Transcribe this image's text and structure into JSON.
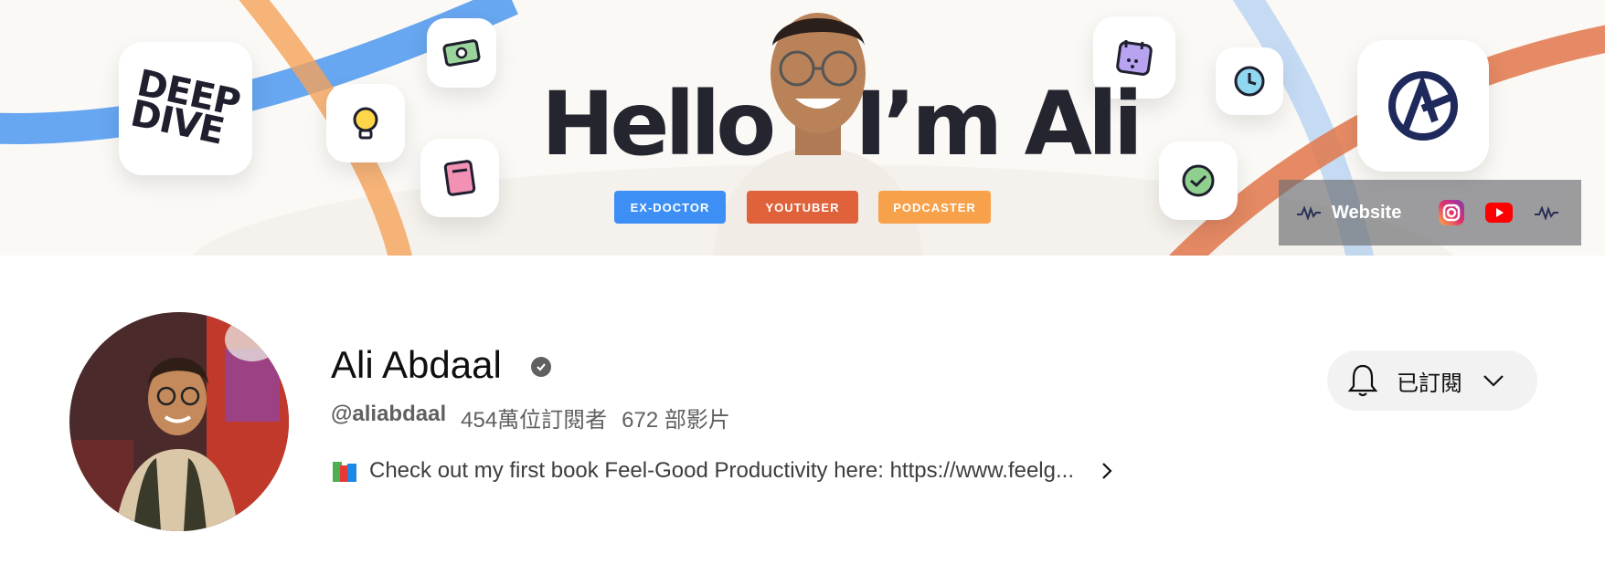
{
  "banner": {
    "deep_dive_logo": "DEEP\nDIVE",
    "headline_left": "Hello",
    "headline_right": "I’m Ali",
    "tags": [
      "EX-DOCTOR",
      "YOUTUBER",
      "PODCASTER"
    ],
    "links": {
      "website_label": "Website",
      "icons": [
        "waveform-icon",
        "instagram-icon",
        "youtube-icon",
        "waveform-icon"
      ]
    }
  },
  "channel": {
    "name": "Ali Abdaal",
    "verified": true,
    "handle": "@aliabdaal",
    "subscribers": "454萬位訂閱者",
    "videos": "672 部影片",
    "description": "Check out my first book Feel-Good Productivity here: https://www.feelg..."
  },
  "subscribe": {
    "label": "已訂閱",
    "icon": "bell-icon"
  },
  "colors": {
    "tag_blue": "#3d8ff5",
    "tag_red": "#e0623a",
    "tag_orange": "#f7a14a",
    "headline": "#25252f",
    "secondary_text": "#606060"
  }
}
